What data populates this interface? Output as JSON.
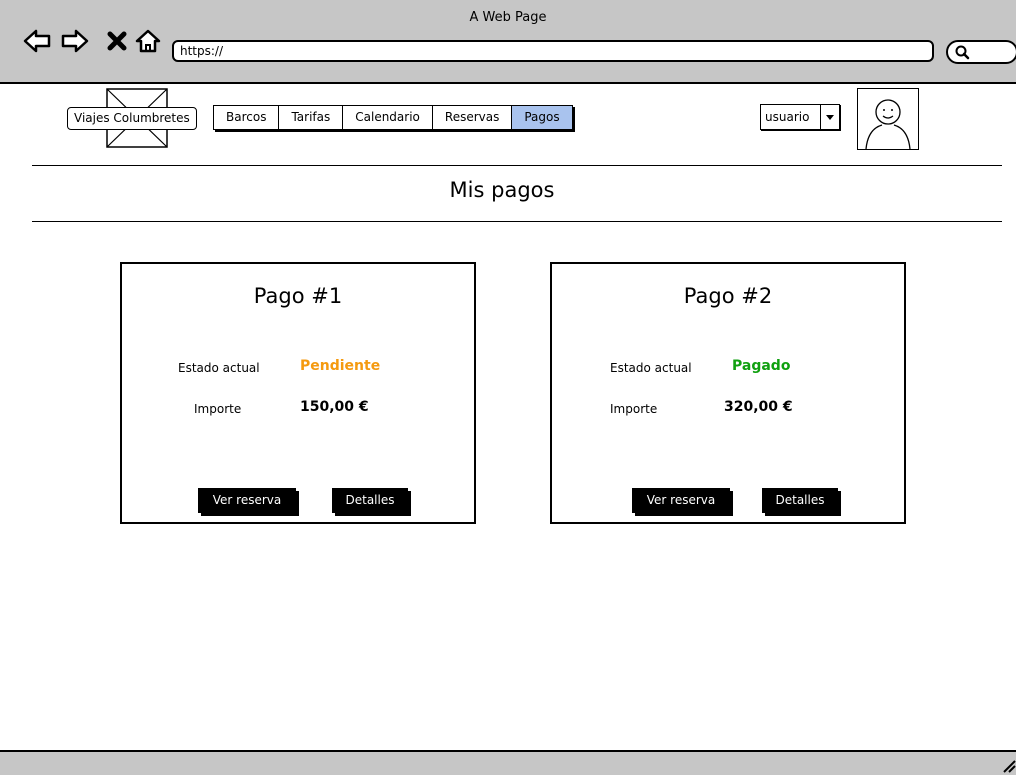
{
  "window": {
    "title": "A Web Page"
  },
  "browser": {
    "url": "https://"
  },
  "header": {
    "logo_label": "Viajes Columbretes",
    "nav": [
      "Barcos",
      "Tarifas",
      "Calendario",
      "Reservas",
      "Pagos"
    ],
    "active_nav": "Pagos",
    "user_select": "usuario"
  },
  "page": {
    "title": "Mis pagos"
  },
  "payments": [
    {
      "title": "Pago #1",
      "status_label": "Estado actual",
      "status": "Pendiente",
      "status_color": "#f59a0f",
      "amount_label": "Importe",
      "amount": "150,00 €",
      "view_label": "Ver reserva",
      "details_label": "Detalles"
    },
    {
      "title": "Pago #2",
      "status_label": "Estado actual",
      "status": "Pagado",
      "status_color": "#10a010",
      "amount_label": "Importe",
      "amount": "320,00 €",
      "view_label": "Ver reserva",
      "details_label": "Detalles"
    }
  ],
  "colors": {
    "chrome": "#c6c6c6",
    "active_tab": "#a9c3ee"
  }
}
